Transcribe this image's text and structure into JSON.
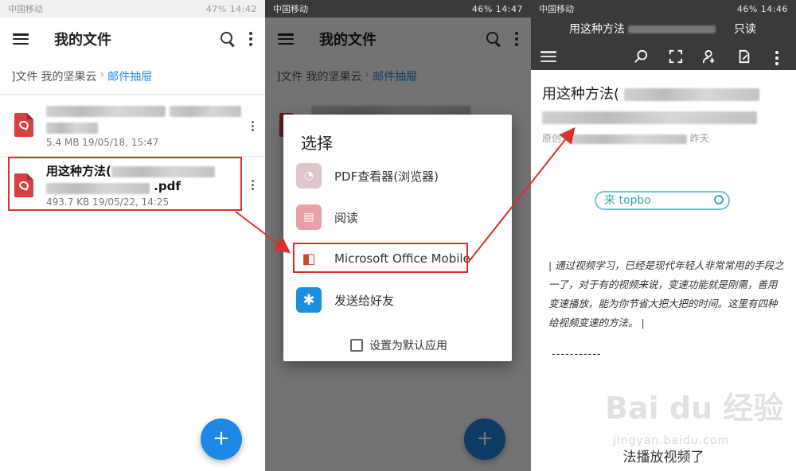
{
  "panel1": {
    "status_bar": {
      "carrier": "中国移动",
      "battery": "47%",
      "time": "14:42"
    },
    "app_bar": {
      "title": "我的文件"
    },
    "breadcrumb": {
      "items": [
        "]文件",
        "我的坚果云"
      ],
      "current": "邮件抽屉"
    },
    "files": [
      {
        "name": "",
        "meta": "5.4 MB 19/05/18, 15:47"
      },
      {
        "name": "用这种方法(",
        "name_suffix": ".pdf",
        "meta": "493.7 KB 19/05/22, 14:25"
      }
    ],
    "fab_label": "+"
  },
  "panel2": {
    "status_bar": {
      "carrier": "中国移动",
      "battery": "46%",
      "time": "14:47"
    },
    "dialog": {
      "title": "选择",
      "options": [
        {
          "label": "PDF查看器(浏览器)",
          "icon": "pdf-viewer-icon"
        },
        {
          "label": "阅读",
          "icon": "reader-book-icon"
        },
        {
          "label": "Microsoft Office Mobile",
          "icon": "office-icon"
        },
        {
          "label": "发送给好友",
          "icon": "send-friend-icon"
        }
      ],
      "checkbox_label": "设置为默认应用"
    }
  },
  "panel3": {
    "status_bar": {
      "carrier": "中国移动",
      "battery": "46%",
      "time": "14:46"
    },
    "header": {
      "title": "用这种方法",
      "mode": "只读"
    },
    "doc": {
      "title": "用这种方法(",
      "meta_prefix": "原创:",
      "meta_suffix": "昨天",
      "search_text": "来 topbo",
      "body": "| 通过视频学习，已经是现代年轻人非常常用的手段之一了，对于有的视频来说，变速功能就是刚需，善用变速播放，能为你节省大把大把的时间。这里有四种给视频变速的方法。 |",
      "dashes": "-----------",
      "footer": "法播放视频了"
    }
  },
  "watermark": {
    "main": "Bai du 经验",
    "sub": "jingyan.baidu.com"
  },
  "colors": {
    "accent": "#1e88e5",
    "highlight": "#d9302c",
    "pdf_red": "#d64040"
  }
}
